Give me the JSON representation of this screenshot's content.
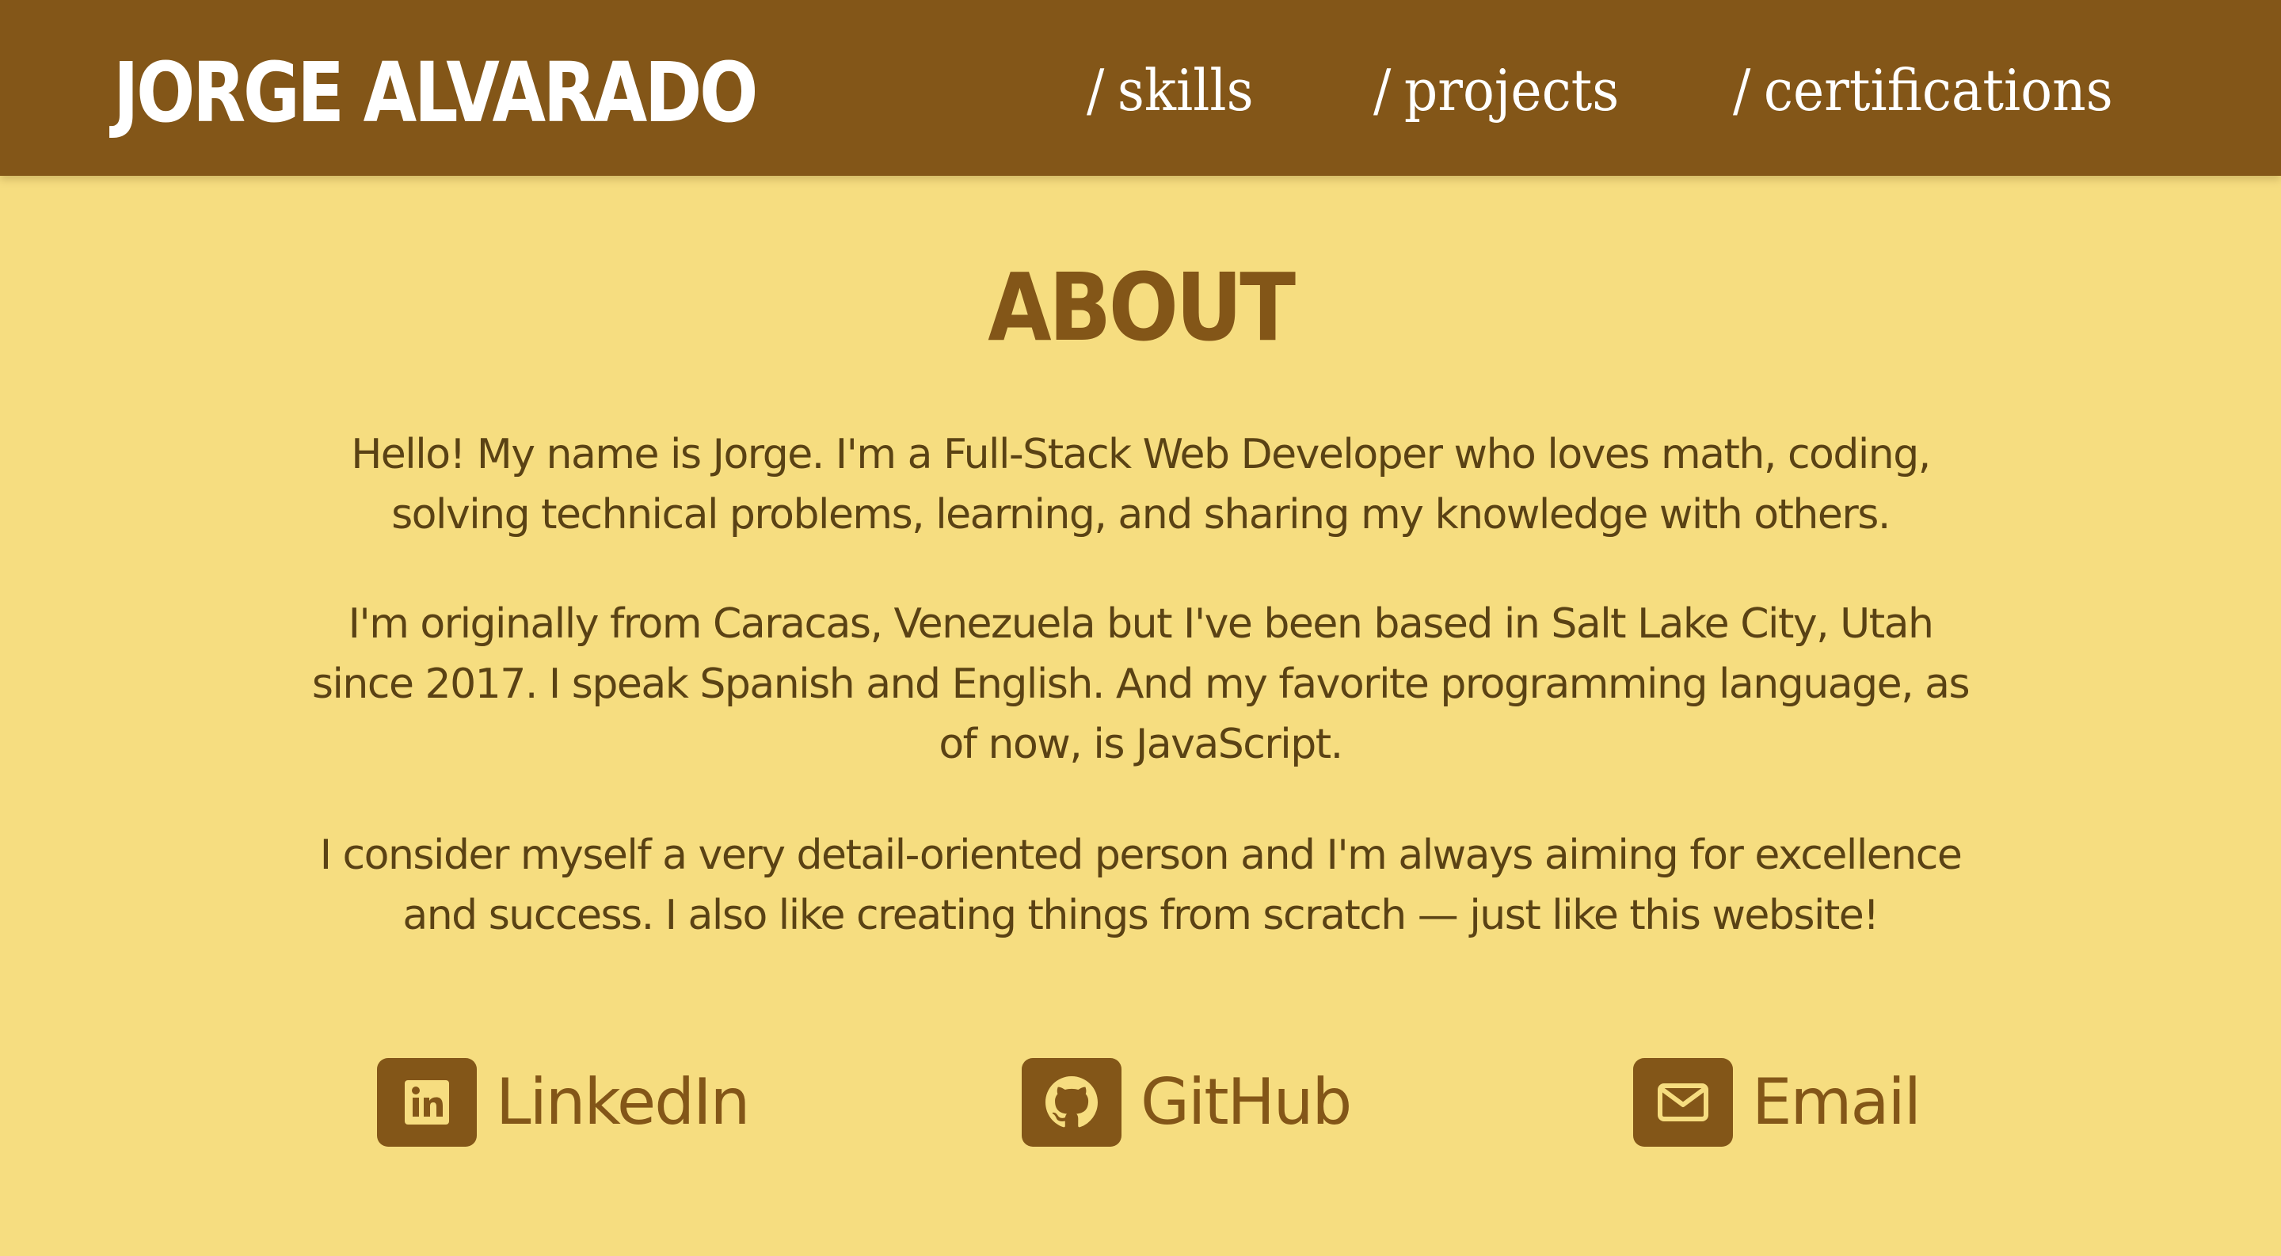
{
  "header": {
    "brand": "JORGE ALVARADO",
    "nav": [
      {
        "slash": "/",
        "label": "skills"
      },
      {
        "slash": "/",
        "label": "projects"
      },
      {
        "slash": "/",
        "label": "certifications"
      }
    ]
  },
  "about": {
    "title": "ABOUT",
    "paragraphs": [
      "Hello! My name is Jorge. I'm a Full-Stack Web Developer who loves math, coding, solving technical problems, learning, and sharing my knowledge with others.",
      "I'm originally from Caracas, Venezuela but I've been based in Salt Lake City, Utah since 2017. I speak Spanish and English. And my favorite programming language, as of now, is JavaScript.",
      "I consider myself a very detail-oriented person and I'm always aiming for excellence and success. I also like creating things from scratch — just like this website!"
    ]
  },
  "social": [
    {
      "label": "LinkedIn",
      "icon": "linkedin-icon"
    },
    {
      "label": "GitHub",
      "icon": "github-icon"
    },
    {
      "label": "Email",
      "icon": "envelope-icon"
    }
  ],
  "colors": {
    "background": "#F6DD80",
    "header": "#835618",
    "accent": "#835618",
    "text": "#5a4214",
    "header_text": "#ffffff"
  }
}
